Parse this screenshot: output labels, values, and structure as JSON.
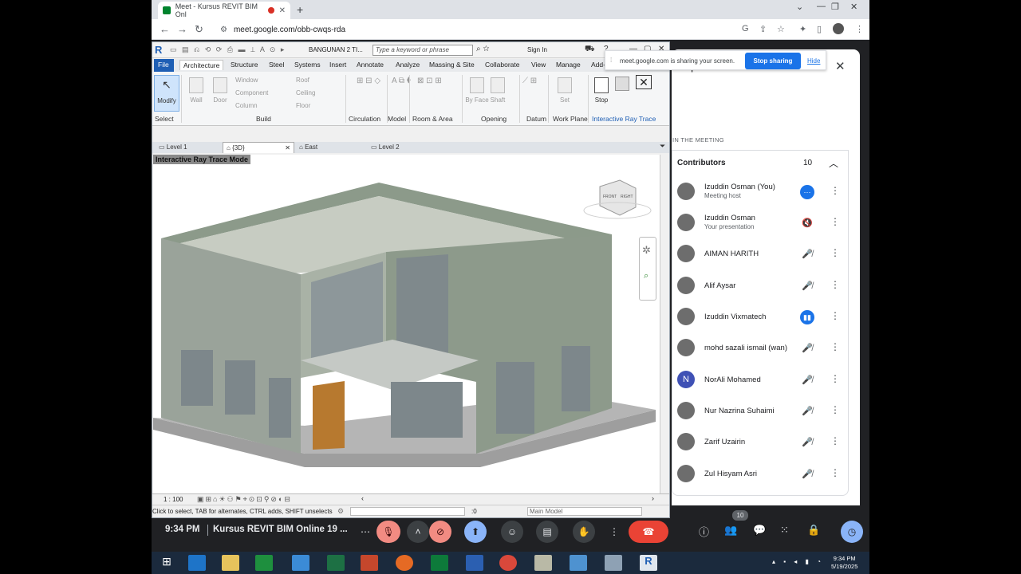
{
  "browser": {
    "tab_title": "Meet - Kursus REVIT BIM Onl",
    "url": "meet.google.com/obb-cwqs-rda"
  },
  "revit": {
    "doc_title": "BANGUNAN 2 TI...",
    "search_placeholder": "Type a keyword or phrase",
    "sign_in": "Sign In",
    "ribbon_tabs": [
      "File",
      "Architecture",
      "Structure",
      "Steel",
      "Systems",
      "Insert",
      "Annotate",
      "Analyze",
      "Massing & Site",
      "Collaborate",
      "View",
      "Manage",
      "Add-Ins"
    ],
    "tools": {
      "modify": "Modify",
      "wall": "Wall",
      "door": "Door",
      "window": "Window",
      "component": "Component",
      "column": "Column",
      "roof": "Roof",
      "ceiling": "Ceiling",
      "floor": "Floor",
      "by_face": "By Face",
      "shaft": "Shaft",
      "set": "Set",
      "stop": "Stop"
    },
    "panels": {
      "select": "Select",
      "build": "Build",
      "circulation": "Circulation",
      "model": "Model",
      "room_area": "Room & Area",
      "opening": "Opening",
      "datum": "Datum",
      "work_plane": "Work Plane",
      "interactive_ray_trace": "Interactive Ray Trace"
    },
    "view_tabs": [
      "Level 1",
      "{3D}",
      "East",
      "Level 2"
    ],
    "viewport_label": "Interactive Ray Trace Mode",
    "viewcube": {
      "front": "FRONT",
      "right": "RIGHT"
    },
    "scale": "1 : 100",
    "status_text": "Click to select, TAB for alternates, CTRL adds, SHIFT unselects",
    "selection_count": ":0",
    "model_select": "Main Model"
  },
  "share_popup": {
    "message": "meet.google.com is sharing your screen.",
    "stop_label": "Stop sharing",
    "hide_label": "Hide"
  },
  "people_panel": {
    "title": "People",
    "section_label": "IN THE MEETING",
    "contributors_label": "Contributors",
    "contributors_count": "10",
    "people": [
      {
        "name": "Izuddin Osman (You)",
        "sub": "Meeting host",
        "mic": "more-active"
      },
      {
        "name": "Izuddin Osman",
        "sub": "Your presentation",
        "mic": "muted-presentation"
      },
      {
        "name": "AIMAN HARITH",
        "sub": "",
        "mic": "muted"
      },
      {
        "name": "Alif Aysar",
        "sub": "",
        "mic": "muted"
      },
      {
        "name": "Izuddin Vixmatech",
        "sub": "",
        "mic": "speaking"
      },
      {
        "name": "mohd sazali ismail (wan)",
        "sub": "",
        "mic": "muted"
      },
      {
        "name": "NorAli Mohamed",
        "sub": "",
        "mic": "muted",
        "initial": "N"
      },
      {
        "name": "Nur Nazrina Suhaimi",
        "sub": "",
        "mic": "muted"
      },
      {
        "name": "Zarif Uzairin",
        "sub": "",
        "mic": "muted"
      },
      {
        "name": "Zul Hisyam Asri",
        "sub": "",
        "mic": "muted"
      }
    ]
  },
  "meet_bar": {
    "time": "9:34 PM",
    "meeting_name": "Kursus REVIT BIM Online 19 ...",
    "people_badge": "10"
  },
  "taskbar": {
    "time": "9:34 PM",
    "date": "5/19/2025"
  },
  "colors": {
    "meet_blue": "#1a73e8",
    "end_call_red": "#ea4335",
    "revit_blue": "#1f5fb4"
  }
}
